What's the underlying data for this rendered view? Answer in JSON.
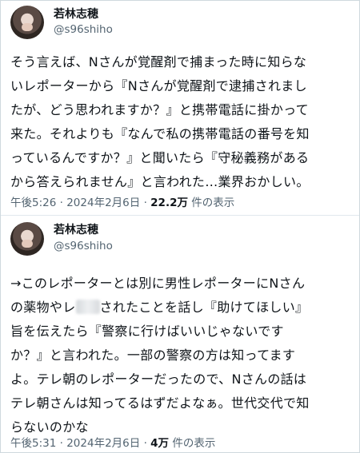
{
  "tweets": [
    {
      "author": {
        "display_name": "若林志穂",
        "handle": "@s96shiho"
      },
      "lines": [
        "そう言えば、Nさんが覚醒剤で捕まった時に知らな",
        "いレポーターから『Nさんが覚醒剤で逮捕されまし",
        "たが、どう思われますか？』と携帯電話に掛かって",
        "来た。それよりも『なんで私の携帯電話の番号を知",
        "っているんですか？』と聞いたら『守秘義務がある",
        "から答えられません』と言われた…業界おかしい。"
      ],
      "time": "午後5:26",
      "separator": "·",
      "date": "2024年2月6日",
      "views_count": "22.2万",
      "views_label": "件の表示"
    },
    {
      "author": {
        "display_name": "若林志穂",
        "handle": "@s96shiho"
      },
      "lines": [
        "→このレポーターとは別に男性レポーターにNさん",
        "の薬物やレ",
        "旨を伝えたら『警察に行けばいいじゃないです",
        "か？』と言われた。一部の警察の方は知ってます",
        "よ。テレ朝のレポーターだったので、Nさんの話は",
        "テレ朝さんは知ってるはずだよなぁ。世代交代で知",
        "らないのかな"
      ],
      "line2_after_blur": "されたことを話し『助けてほしい』",
      "time": "午後5:31",
      "separator": "·",
      "date": "2024年2月6日",
      "views_count": "4万",
      "views_label": "件の表示"
    }
  ]
}
